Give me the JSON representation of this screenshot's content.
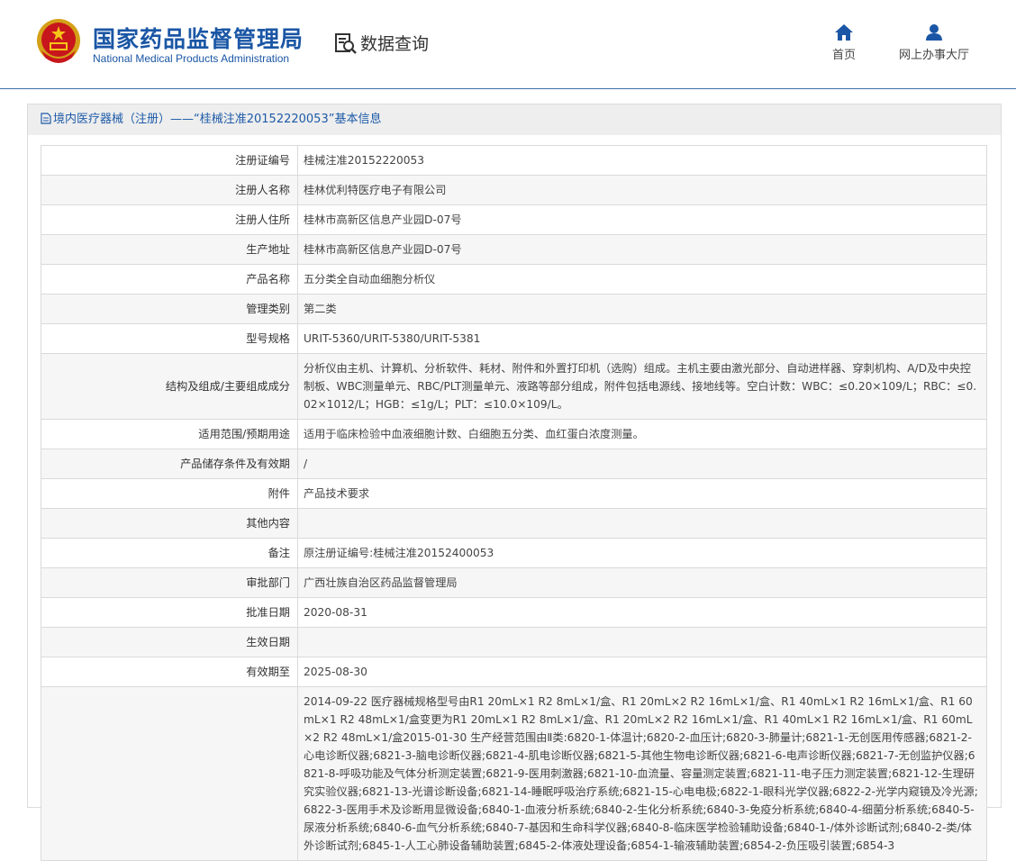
{
  "header": {
    "title_cn": "国家药品监督管理局",
    "title_en": "National Medical Products Administration",
    "data_query_label": "数据查询",
    "nav": [
      {
        "label": "首页",
        "icon": "home-icon"
      },
      {
        "label": "网上办事大厅",
        "icon": "user-icon"
      }
    ]
  },
  "panel": {
    "title": "境内医疗器械（注册）——“桂械注准20152220053”基本信息"
  },
  "rows": [
    {
      "key": "注册证编号",
      "value": "桂械注准20152220053"
    },
    {
      "key": "注册人名称",
      "value": "桂林优利特医疗电子有限公司"
    },
    {
      "key": "注册人住所",
      "value": "桂林市高新区信息产业园D-07号"
    },
    {
      "key": "生产地址",
      "value": "桂林市高新区信息产业园D-07号"
    },
    {
      "key": "产品名称",
      "value": "五分类全自动血细胞分析仪"
    },
    {
      "key": "管理类别",
      "value": "第二类"
    },
    {
      "key": "型号规格",
      "value": "URIT-5360/URIT-5380/URIT-5381"
    },
    {
      "key": "结构及组成/主要组成成分",
      "value": "分析仪由主机、计算机、分析软件、耗材、附件和外置打印机（选购）组成。主机主要由激光部分、自动进样器、穿刺机构、A/D及中央控制板、WBC测量单元、RBC/PLT测量单元、液路等部分组成，附件包括电源线、接地线等。空白计数：WBC：≤0.20×109/L；RBC：≤0.02×1012/L；HGB：≤1g/L；PLT：≤10.0×109/L。"
    },
    {
      "key": "适用范围/预期用途",
      "value": "适用于临床检验中血液细胞计数、白细胞五分类、血红蛋白浓度测量。"
    },
    {
      "key": "产品储存条件及有效期",
      "value": "/"
    },
    {
      "key": "附件",
      "value": "产品技术要求"
    },
    {
      "key": "其他内容",
      "value": ""
    },
    {
      "key": "备注",
      "value": "原注册证编号:桂械注准20152400053"
    },
    {
      "key": "审批部门",
      "value": "广西壮族自治区药品监督管理局"
    },
    {
      "key": "批准日期",
      "value": "2020-08-31"
    },
    {
      "key": "生效日期",
      "value": ""
    },
    {
      "key": "有效期至",
      "value": "2025-08-30"
    },
    {
      "key": "",
      "value": "2014-09-22 医疗器械规格型号由R1 20mL×1 R2 8mL×1/盒、R1 20mL×2 R2 16mL×1/盒、R1 40mL×1 R2 16mL×1/盒、R1 60mL×1 R2 48mL×1/盒变更为R1 20mL×1 R2 8mL×1/盒、R1 20mL×2 R2 16mL×1/盒、R1 40mL×1 R2 16mL×1/盒、R1 60mL×2 R2 48mL×1/盒2015-01-30 生产经营范围由Ⅱ类:6820-1-体温计;6820-2-血压计;6820-3-肺量计;6821-1-无创医用传感器;6821-2-心电诊断仪器;6821-3-脑电诊断仪器;6821-4-肌电诊断仪器;6821-5-其他生物电诊断仪器;6821-6-电声诊断仪器;6821-7-无创监护仪器;6821-8-呼吸功能及气体分析测定装置;6821-9-医用刺激器;6821-10-血流量、容量测定装置;6821-11-电子压力测定装置;6821-12-生理研究实验仪器;6821-13-光谱诊断设备;6821-14-睡眠呼吸治疗系统;6821-15-心电电极;6822-1-眼科光学仪器;6822-2-光学内窥镜及冷光源;6822-3-医用手术及诊断用显微设备;6840-1-血液分析系统;6840-2-生化分析系统;6840-3-免疫分析系统;6840-4-细菌分析系统;6840-5-尿液分析系统;6840-6-血气分析系统;6840-7-基因和生命科学仪器;6840-8-临床医学检验辅助设备;6840-1-/体外诊断试剂;6840-2-类/体外诊断试剂;6845-1-人工心肺设备辅助装置;6845-2-体液处理设备;6854-1-输液辅助装置;6854-2-负压吸引装置;6854-3"
    }
  ]
}
